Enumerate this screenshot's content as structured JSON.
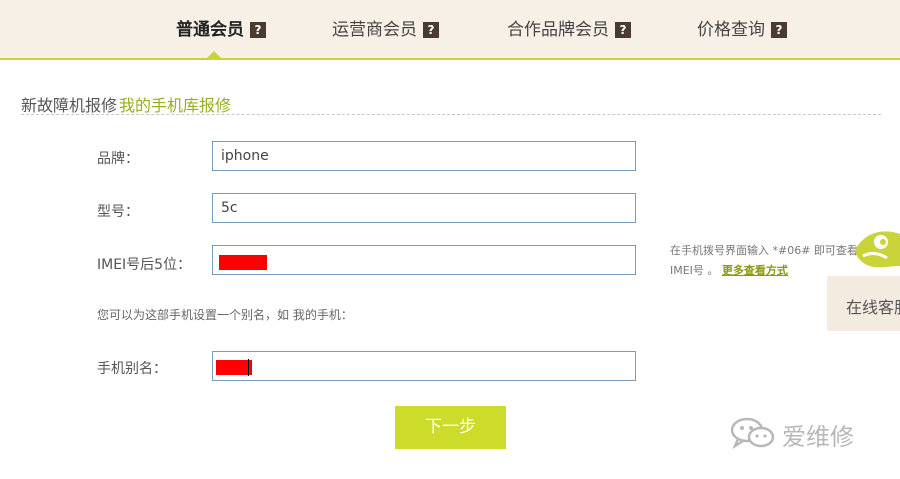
{
  "nav": {
    "tabs": [
      {
        "label": "普通会员",
        "help": "?"
      },
      {
        "label": "运营商会员",
        "help": "?"
      },
      {
        "label": "合作品牌会员",
        "help": "?"
      },
      {
        "label": "价格查询",
        "help": "?"
      }
    ],
    "active_tab": "普通会员"
  },
  "section": {
    "title": "新故障机报修",
    "subtitle": "我的手机库报修"
  },
  "form": {
    "brand": {
      "label": "品牌：",
      "value": "iphone"
    },
    "model": {
      "label": "型号：",
      "value": "5c"
    },
    "imei": {
      "label": "IMEI号后5位：",
      "value": ""
    },
    "alias_hint": "您可以为这部手机设置一个别名，如 我的手机：",
    "alias": {
      "label": "手机别名：",
      "value": ""
    },
    "next_label": "下一步"
  },
  "help": {
    "line1": "在手机拨号界面输入 *#06# 即可查看",
    "line2": "IMEI号 。",
    "link": "更多查看方式"
  },
  "service": {
    "label": "在线客服"
  },
  "watermark": {
    "text": "爱维修"
  },
  "colors": {
    "accent": "#cddc2b",
    "nav_background": "#f7f0e6",
    "help_badge": "#4a3b32",
    "redaction": "#ff0000"
  }
}
